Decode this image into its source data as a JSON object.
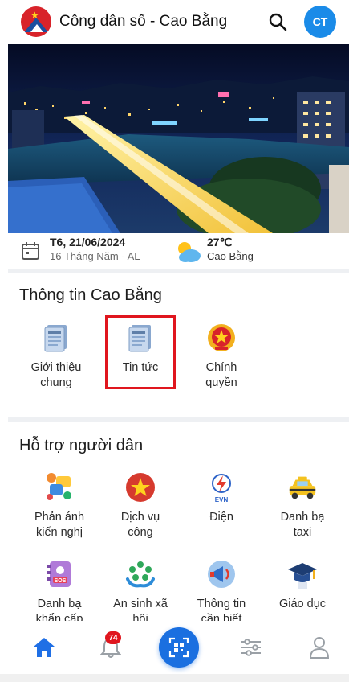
{
  "header": {
    "title": "Công dân số - Cao Bằng",
    "avatar_initials": "CT",
    "logo_icon": "cao-bang-emblem-icon",
    "search_icon": "search-icon"
  },
  "info": {
    "date_main": "T6, 21/06/2024",
    "date_lunar": "16 Tháng Năm - AL",
    "temperature": "27℃",
    "location": "Cao Bằng",
    "calendar_icon": "calendar-icon",
    "weather_icon": "partly-cloudy-icon"
  },
  "section_info": {
    "title": "Thông tin Cao Bằng",
    "items": [
      {
        "label_line1": "Giới thiệu",
        "label_line2": "chung",
        "icon": "newspaper-icon"
      },
      {
        "label_line1": "Tin tức",
        "label_line2": "",
        "icon": "newspaper-icon"
      },
      {
        "label_line1": "Chính",
        "label_line2": "quyền",
        "icon": "national-emblem-icon"
      }
    ]
  },
  "section_support": {
    "title": "Hỗ trợ người dân",
    "items": [
      {
        "label_line1": "Phản ánh",
        "label_line2": "kiến nghị",
        "icon": "feedback-icon"
      },
      {
        "label_line1": "Dịch vụ",
        "label_line2": "công",
        "icon": "public-service-icon"
      },
      {
        "label_line1": "Điện",
        "label_line2": "",
        "icon": "evn-electricity-icon"
      },
      {
        "label_line1": "Danh bạ",
        "label_line2": "taxi",
        "icon": "taxi-icon"
      },
      {
        "label_line1": "Danh bạ",
        "label_line2": "khẩn cấp",
        "icon": "sos-contacts-icon"
      },
      {
        "label_line1": "An sinh xã",
        "label_line2": "hội",
        "icon": "social-welfare-icon"
      },
      {
        "label_line1": "Thông tin",
        "label_line2": "cần biết",
        "icon": "megaphone-icon"
      },
      {
        "label_line1": "Giáo dục",
        "label_line2": "",
        "icon": "graduation-cap-icon"
      }
    ]
  },
  "bottom_nav": {
    "notification_count": "74",
    "items": [
      "home-icon",
      "bell-icon",
      "qr-scan-icon",
      "settings-sliders-icon",
      "user-icon"
    ]
  },
  "colors": {
    "accent": "#1a6fe0",
    "avatar": "#1a8be8",
    "highlight": "#e0161e"
  }
}
